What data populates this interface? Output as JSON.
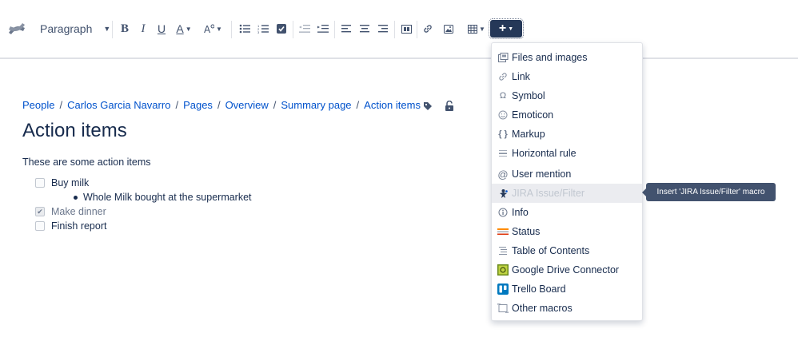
{
  "toolbar": {
    "paragraph_label": "Paragraph",
    "bold": "B",
    "italic": "I",
    "underline": "U",
    "text_color": "A",
    "insert": "+"
  },
  "breadcrumb": [
    "People",
    "Carlos Garcia Navarro",
    "Pages",
    "Overview",
    "Summary page",
    "Action items"
  ],
  "page": {
    "title": "Action items",
    "intro": "These are some action items",
    "tasks": [
      {
        "label": "Buy milk",
        "checked": false
      },
      {
        "label": "Make dinner",
        "checked": true
      },
      {
        "label": "Finish report",
        "checked": false
      }
    ],
    "sub_bullet": "Whole Milk bought at the supermarket"
  },
  "insert_menu": {
    "items": [
      {
        "label": "Files and images",
        "icon": "files-icon"
      },
      {
        "label": "Link",
        "icon": "link-icon"
      },
      {
        "label": "Symbol",
        "icon": "omega-icon"
      },
      {
        "label": "Emoticon",
        "icon": "smiley-icon"
      },
      {
        "label": "Markup",
        "icon": "markup-icon"
      },
      {
        "label": "Horizontal rule",
        "icon": "rule-icon"
      },
      {
        "label": "User mention",
        "icon": "at-icon"
      },
      {
        "label": "JIRA Issue/Filter",
        "icon": "jira-icon"
      },
      {
        "label": "Info",
        "icon": "info-icon"
      },
      {
        "label": "Status",
        "icon": "status-icon"
      },
      {
        "label": "Table of Contents",
        "icon": "toc-icon"
      },
      {
        "label": "Google Drive Connector",
        "icon": "google-drive-icon"
      },
      {
        "label": "Trello Board",
        "icon": "trello-icon"
      },
      {
        "label": "Other macros",
        "icon": "macros-icon"
      }
    ],
    "tooltip": "Insert 'JIRA Issue/Filter' macro"
  },
  "colors": {
    "link": "#0052cc",
    "insert_button": "#253858",
    "tooltip": "#42526e"
  }
}
